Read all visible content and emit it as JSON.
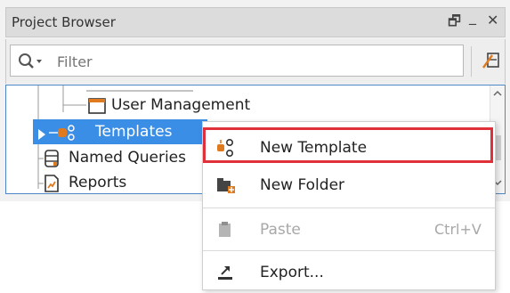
{
  "panel": {
    "title": "Project Browser",
    "window_controls": {
      "restore": "🗗",
      "minimize": "_",
      "close": "✕"
    }
  },
  "filter": {
    "placeholder": "Filter"
  },
  "tree": {
    "items": [
      {
        "label": "User Management",
        "icon": "window-icon"
      },
      {
        "label": "Templates",
        "icon": "templates-icon",
        "selected": true
      },
      {
        "label": "Named Queries",
        "icon": "database-icon"
      },
      {
        "label": "Reports",
        "icon": "report-icon"
      }
    ]
  },
  "context_menu": {
    "items": [
      {
        "label": "New Template",
        "icon": "new-template-icon",
        "highlighted": true
      },
      {
        "label": "New Folder",
        "icon": "new-folder-icon"
      },
      {
        "label": "Paste",
        "shortcut": "Ctrl+V",
        "icon": "paste-icon",
        "disabled": true
      },
      {
        "label": "Export...",
        "icon": "export-icon"
      }
    ]
  },
  "colors": {
    "selection": "#3b8ee6",
    "highlight_border": "#e0303a",
    "icon_accent": "#e07a1f",
    "icon_dark": "#333333"
  }
}
